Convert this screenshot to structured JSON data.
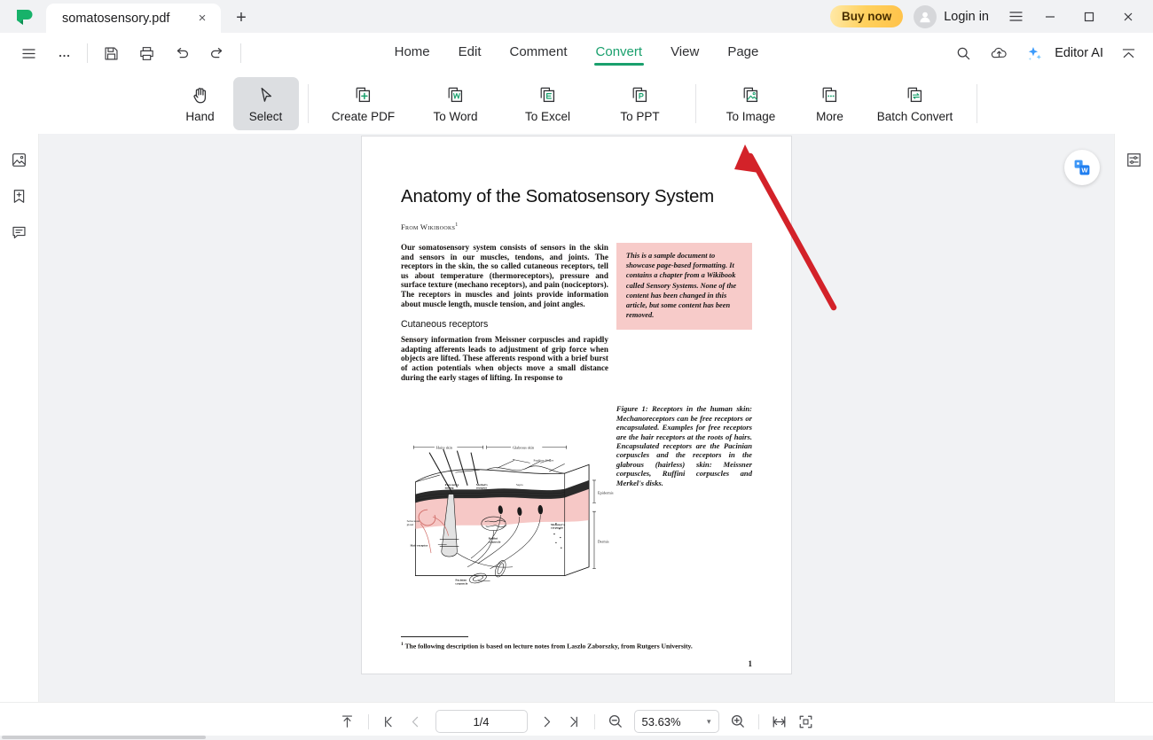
{
  "window": {
    "logo": "sprite-logo-icon",
    "tab": {
      "title": "somatosensory.pdf",
      "close": "×"
    },
    "new_tab": "+",
    "buy_now": "Buy now",
    "login": "Login in",
    "minimize": "—",
    "maximize": "□",
    "close": "✕"
  },
  "menubar": {
    "quick": [
      "hamburger-icon",
      "more-icon",
      "save-icon",
      "print-icon",
      "undo-icon",
      "redo-icon"
    ],
    "tabs": [
      {
        "label": "Home",
        "active": false
      },
      {
        "label": "Edit",
        "active": false
      },
      {
        "label": "Comment",
        "active": false
      },
      {
        "label": "Convert",
        "active": true
      },
      {
        "label": "View",
        "active": false
      },
      {
        "label": "Page",
        "active": false
      }
    ],
    "editor_ai": "Editor AI",
    "accent_green": "#1aa06d"
  },
  "ribbon": {
    "items": [
      {
        "label": "Hand",
        "icon": "hand-icon",
        "active": false
      },
      {
        "label": "Select",
        "icon": "cursor-icon",
        "active": true
      },
      {
        "label": "Create PDF",
        "icon": "create-pdf-icon",
        "active": false
      },
      {
        "label": "To Word",
        "icon": "to-word-icon",
        "active": false
      },
      {
        "label": "To Excel",
        "icon": "to-excel-icon",
        "active": false
      },
      {
        "label": "To PPT",
        "icon": "to-ppt-icon",
        "active": false
      },
      {
        "label": "To Image",
        "icon": "to-image-icon",
        "active": false
      },
      {
        "label": "More",
        "icon": "more-dots-icon",
        "active": false
      },
      {
        "label": "Batch Convert",
        "icon": "batch-convert-icon",
        "active": false
      }
    ]
  },
  "left_sidebar": {
    "items": [
      "thumbnails-icon",
      "bookmark-add-icon",
      "comment-icon"
    ]
  },
  "right_sidebar": {
    "items": [
      "properties-sliders-icon"
    ]
  },
  "document": {
    "title": "Anatomy of the Somatosensory System",
    "from": "From Wikibooks",
    "from_sup": "1",
    "paragraph1": "Our somatosensory system consists of sensors in the skin and sensors in our muscles, tendons, and joints. The receptors in the skin, the so called cutaneous receptors, tell us about temperature (thermoreceptors), pressure and surface texture (mechano receptors), and pain (nociceptors). The receptors in muscles and joints provide information about muscle length, muscle tension, and joint angles.",
    "section_heading": "Cutaneous receptors",
    "paragraph2": "Sensory information from Meissner corpuscles and rapidly adapting afferents leads to adjustment of grip force when objects are lifted. These afferents respond with a brief burst of action potentials when objects move a small distance during the early stages of lifting. In response to",
    "callout": "This is a sample document to showcase page-based formatting. It contains a chapter from a Wikibook called Sensory Systems. None of the content has been changed in this article, but some content has been removed.",
    "figure_caption": "Figure 1:   Receptors in the human skin: Mechanoreceptors can be free receptors or encapsulated. Examples for free receptors are the hair receptors at the roots of hairs. Encapsulated receptors are the Pacinian corpuscles and the receptors in the glabrous (hairless) skin: Meissner corpuscles, Ruffini corpuscles and Merkel's disks.",
    "figure_labels": {
      "hairy_skin": "Hairy skin",
      "glabrous_skin": "Glabrous skin",
      "papillary_ridges": "Papillary Ridges",
      "epidermis": "Epidermis",
      "dermis": "Dermis",
      "septa": "Septa",
      "free_nerve_ending": "Free nerve ending",
      "merkel": "Merkel's receptor",
      "sebaceous_gland": "Sebaceous gland",
      "hair_receptor": "Hair receptor",
      "meissner": "Meissner's corpuscle",
      "ruffini": "Ruffini corpuscle",
      "pacinian": "Pacinian corpuscle"
    },
    "footnote_sup": "1",
    "footnote": "The following description is based on lecture notes from Laszlo Zaborszky, from Rutgers University.",
    "page_number": "1"
  },
  "overlay": {
    "convert_to_word_button": "to-word-floating-icon",
    "annotation_arrow": "red-arrow-annotation",
    "arrow_color": "#d32229"
  },
  "statusbar": {
    "fit_icon": "fit-page-icon",
    "first_page_icon": "first-page-icon",
    "prev_page_icon": "prev-page-icon",
    "page_value": "1/4",
    "next_page_icon": "next-page-icon",
    "last_page_icon": "last-page-icon",
    "zoom_out_icon": "zoom-out-icon",
    "zoom_value": "53.63%",
    "zoom_caret": "▾",
    "zoom_in_icon": "zoom-in-icon",
    "page_fit_icon": "page-width-icon",
    "full_screen_icon": "full-screen-icon"
  }
}
